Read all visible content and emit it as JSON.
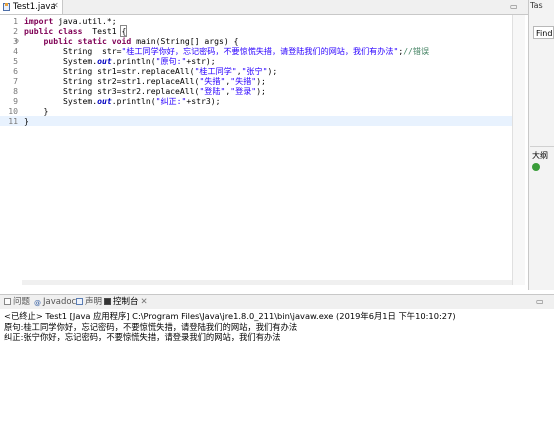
{
  "editor": {
    "tab_label": "Test1.java",
    "tab_close": "✕",
    "lines": [
      {
        "num": "1",
        "fold": "",
        "html": "<span class='kw'>import</span> java.util.*;"
      },
      {
        "num": "2",
        "fold": "",
        "html": "<span class='kw'>public</span> <span class='kw'>class</span>  Test1 <span class='brk'>{</span>"
      },
      {
        "num": "3",
        "fold": "⊖",
        "html": "    <span class='kw'>public</span> <span class='kw'>static</span> <span class='kw'>void</span> main(String[] args) {"
      },
      {
        "num": "4",
        "fold": "",
        "html": "        String  str=<span class='str'>\"桂工同学你好，忘记密码，不要惊慌失措，请登陆我们的网站，我们有办法\"</span>;<span class='cmt'>//错误</span>"
      },
      {
        "num": "5",
        "fold": "",
        "html": "        System.<span class='fld'>out</span>.println(<span class='str'>\"原句:\"</span>+str);"
      },
      {
        "num": "6",
        "fold": "",
        "html": "        String str1=str.replaceAll(<span class='str'>\"桂工同学\"</span>,<span class='str'>\"张宁\"</span>);"
      },
      {
        "num": "7",
        "fold": "",
        "html": "        String str2=str1.replaceAll(<span class='str'>\"失措\"</span>,<span class='str'>\"失措\"</span>);"
      },
      {
        "num": "8",
        "fold": "",
        "html": "        String str3=str2.replaceAll(<span class='str'>\"登陆\"</span>,<span class='str'>\"登录\"</span>);"
      },
      {
        "num": "9",
        "fold": "",
        "html": "        System.<span class='fld'>out</span>.println(<span class='str'>\"纠正:\"</span>+str3);"
      },
      {
        "num": "10",
        "fold": "",
        "html": "    }"
      },
      {
        "num": "11",
        "fold": "",
        "html": "}"
      }
    ]
  },
  "right_panel": {
    "tab_label": "Tas",
    "find_placeholder": "Find",
    "outline_label": "大纲"
  },
  "bottom": {
    "tabs": [
      {
        "label": "问题",
        "icon": "problems-icon"
      },
      {
        "label": "Javadoc",
        "icon": "javadoc-icon"
      },
      {
        "label": "声明",
        "icon": "declaration-icon"
      },
      {
        "label": "控制台",
        "icon": "console-icon",
        "active": true
      }
    ],
    "console_header": "<已终止> Test1 [Java 应用程序] C:\\Program Files\\Java\\jre1.8.0_211\\bin\\javaw.exe  (2019年6月1日 下午10:10:27)",
    "output": [
      "原句:桂工同学你好，忘记密码，不要惊慌失措，请登陆我们的网站，我们有办法",
      "纠正:张宁你好，忘记密码，不要惊慌失措，请登录我们的网站，我们有办法"
    ]
  }
}
